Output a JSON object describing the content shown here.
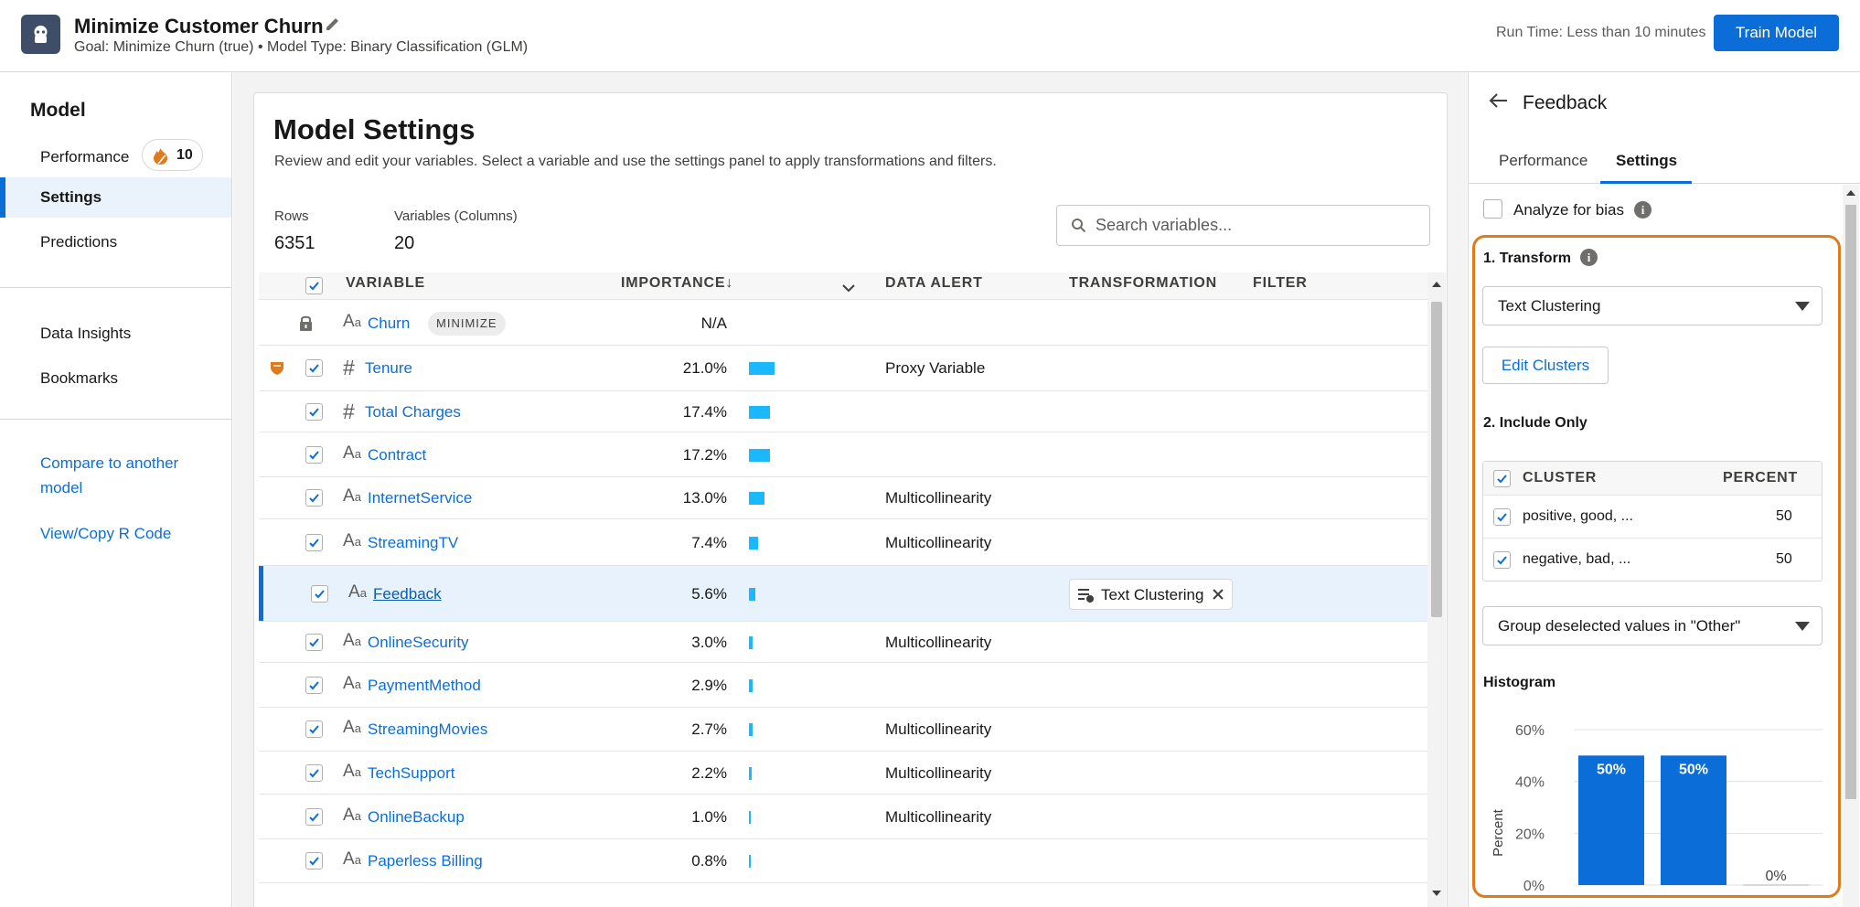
{
  "header": {
    "title": "Minimize Customer Churn",
    "subtitle": "Goal: Minimize Churn (true) • Model Type: Binary Classification (GLM)",
    "run_time": "Run Time: Less than 10 minutes",
    "train_button": "Train Model"
  },
  "nav": {
    "section_title": "Model",
    "items": [
      {
        "label": "Performance",
        "badge": "10"
      },
      {
        "label": "Settings",
        "active": true
      },
      {
        "label": "Predictions"
      },
      {
        "label": "Data Insights"
      },
      {
        "label": "Bookmarks"
      }
    ],
    "links": [
      "Compare to another model",
      "View/Copy R Code"
    ]
  },
  "main": {
    "title": "Model Settings",
    "description": "Review and edit your variables. Select a variable and use the settings panel to apply transformations and filters.",
    "rows_label": "Rows",
    "rows_value": "6351",
    "vars_label": "Variables (Columns)",
    "vars_value": "20",
    "search_placeholder": "Search variables..."
  },
  "table": {
    "headers": {
      "variable": "VARIABLE",
      "importance": "IMPORTANCE↓",
      "data_alert": "DATA ALERT",
      "transformation": "TRANSFORMATION",
      "filter": "FILTER"
    },
    "rows": [
      {
        "name": "Churn",
        "type": "text",
        "badge": "MINIMIZE",
        "importance": "N/A",
        "importance_value": null,
        "alert": "",
        "locked": true
      },
      {
        "name": "Tenure",
        "type": "number",
        "importance": "21.0%",
        "importance_value": 21.0,
        "alert": "Proxy Variable",
        "warning": true
      },
      {
        "name": "Total Charges",
        "type": "number",
        "importance": "17.4%",
        "importance_value": 17.4,
        "alert": ""
      },
      {
        "name": "Contract",
        "type": "text",
        "importance": "17.2%",
        "importance_value": 17.2,
        "alert": ""
      },
      {
        "name": "InternetService",
        "type": "text",
        "importance": "13.0%",
        "importance_value": 13.0,
        "alert": "Multicollinearity"
      },
      {
        "name": "StreamingTV",
        "type": "text",
        "importance": "7.4%",
        "importance_value": 7.4,
        "alert": "Multicollinearity"
      },
      {
        "name": "Feedback",
        "type": "text",
        "importance": "5.6%",
        "importance_value": 5.6,
        "alert": "",
        "transformation": "Text Clustering",
        "selected": true
      },
      {
        "name": "OnlineSecurity",
        "type": "text",
        "importance": "3.0%",
        "importance_value": 3.0,
        "alert": "Multicollinearity"
      },
      {
        "name": "PaymentMethod",
        "type": "text",
        "importance": "2.9%",
        "importance_value": 2.9,
        "alert": ""
      },
      {
        "name": "StreamingMovies",
        "type": "text",
        "importance": "2.7%",
        "importance_value": 2.7,
        "alert": "Multicollinearity"
      },
      {
        "name": "TechSupport",
        "type": "text",
        "importance": "2.2%",
        "importance_value": 2.2,
        "alert": "Multicollinearity"
      },
      {
        "name": "OnlineBackup",
        "type": "text",
        "importance": "1.0%",
        "importance_value": 1.0,
        "alert": "Multicollinearity"
      },
      {
        "name": "Paperless Billing",
        "type": "text",
        "importance": "0.8%",
        "importance_value": 0.8,
        "alert": ""
      }
    ]
  },
  "panel": {
    "title": "Feedback",
    "tabs": [
      "Performance",
      "Settings"
    ],
    "active_tab": "Settings",
    "analyze_bias": "Analyze for bias",
    "transform_label": "1. Transform",
    "transform_value": "Text Clustering",
    "edit_clusters": "Edit Clusters",
    "include_only_label": "2. Include Only",
    "cluster_header": "CLUSTER",
    "percent_header": "PERCENT",
    "clusters": [
      {
        "name": "positive, good, ...",
        "percent": "50"
      },
      {
        "name": "negative, bad, ...",
        "percent": "50"
      }
    ],
    "group_select": "Group deselected values in \"Other\"",
    "histogram_label": "Histogram"
  },
  "chart_data": {
    "type": "bar",
    "ylabel": "Percent",
    "ylim": [
      0,
      60
    ],
    "yticks": [
      "0%",
      "20%",
      "40%",
      "60%"
    ],
    "values": [
      50,
      50,
      0
    ],
    "data_labels": [
      "50%",
      "50%",
      "0%"
    ],
    "color": "#0b6ed8"
  },
  "colors": {
    "accent": "#0b6ed8",
    "importance_bar": "#1ab9ff",
    "highlight": "#e07b1c",
    "warning": "#e07b1c"
  }
}
